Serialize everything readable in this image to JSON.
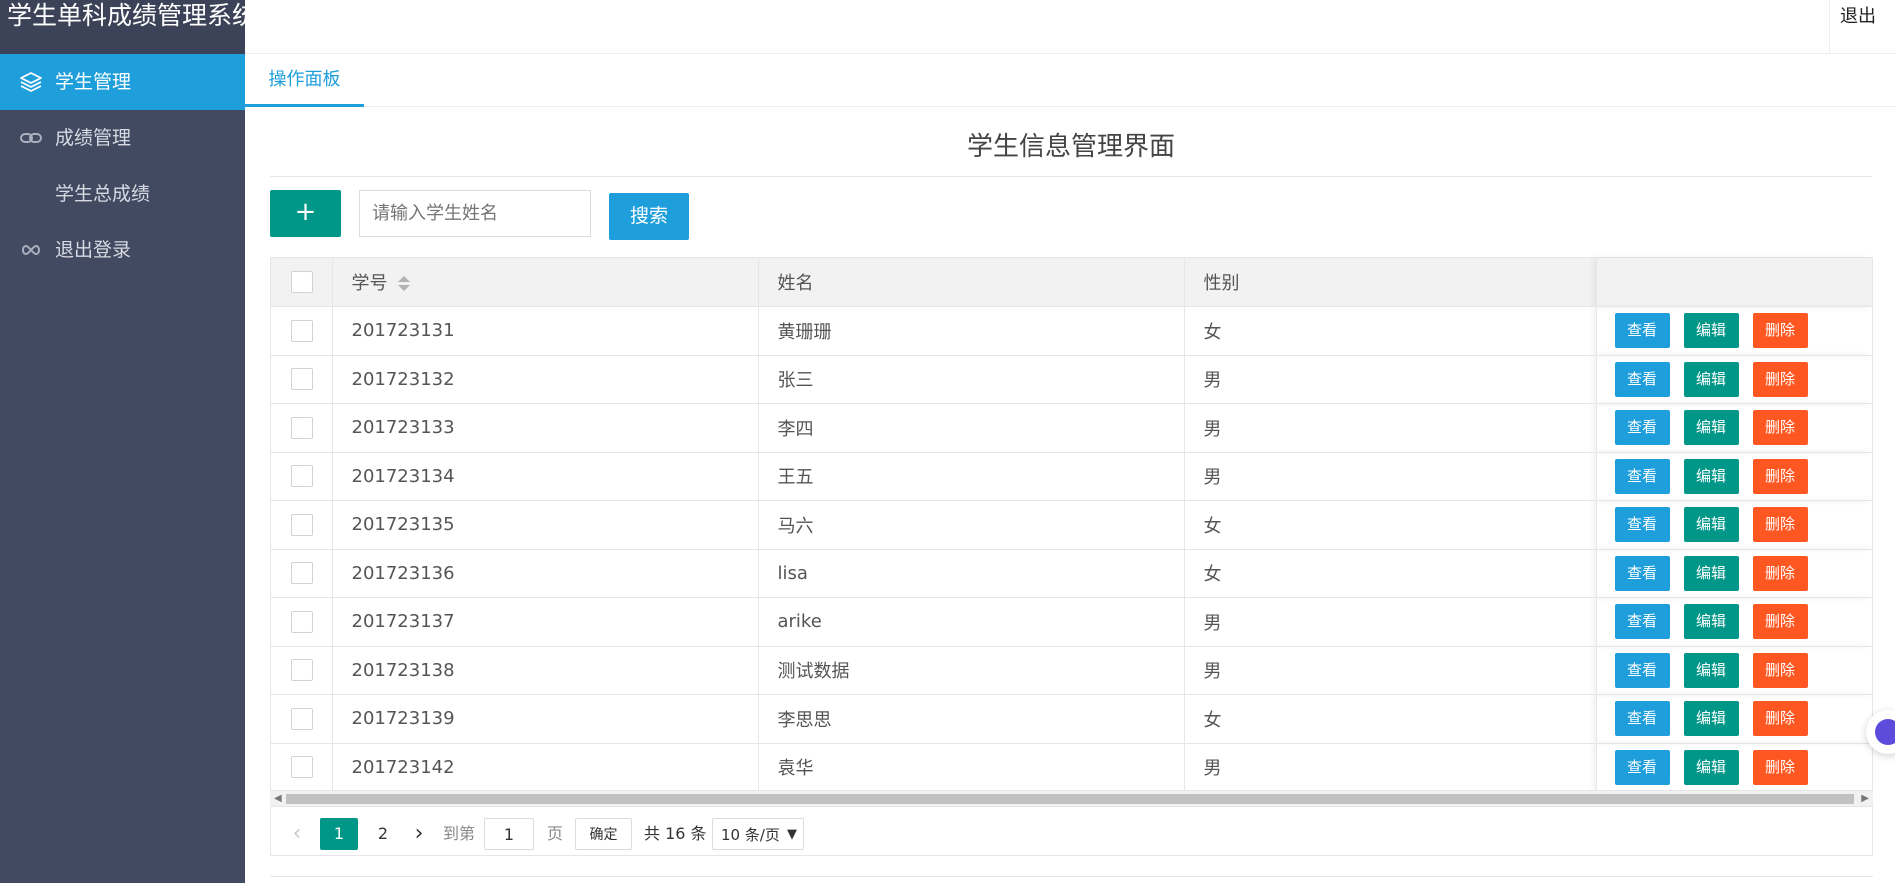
{
  "app": {
    "title": "学生单科成绩管理系统",
    "logout_label": "退出"
  },
  "sidebar": {
    "items": [
      {
        "label": "学生管理",
        "icon": "layers-icon",
        "active": true
      },
      {
        "label": "成绩管理",
        "icon": "link-icon",
        "active": false
      },
      {
        "label": "学生总成绩",
        "icon": "",
        "active": false
      },
      {
        "label": "退出登录",
        "icon": "infinity-icon",
        "active": false
      }
    ]
  },
  "tabs": [
    {
      "label": "操作面板",
      "active": true
    }
  ],
  "main": {
    "title": "学生信息管理界面",
    "add_label": "+",
    "search": {
      "placeholder": "请输入学生姓名",
      "value": ""
    },
    "search_label": "搜索"
  },
  "table": {
    "columns": [
      "学号",
      "姓名",
      "性别",
      ""
    ],
    "rows": [
      {
        "id": "201723131",
        "name": "黄珊珊",
        "gender": "女"
      },
      {
        "id": "201723132",
        "name": "张三",
        "gender": "男"
      },
      {
        "id": "201723133",
        "name": "李四",
        "gender": "男"
      },
      {
        "id": "201723134",
        "name": "王五",
        "gender": "男"
      },
      {
        "id": "201723135",
        "name": "马六",
        "gender": "女"
      },
      {
        "id": "201723136",
        "name": "lisa",
        "gender": "女"
      },
      {
        "id": "201723137",
        "name": "arike",
        "gender": "男"
      },
      {
        "id": "201723138",
        "name": "测试数据",
        "gender": "男"
      },
      {
        "id": "201723139",
        "name": "李思思",
        "gender": "女"
      },
      {
        "id": "201723142",
        "name": "袁华",
        "gender": "男"
      }
    ],
    "actions": {
      "view": "查看",
      "edit": "编辑",
      "delete": "删除"
    }
  },
  "pagination": {
    "prev": "‹",
    "next": "›",
    "current": "1",
    "pages": [
      "1",
      "2"
    ],
    "goto_label": "到第",
    "goto_value": "1",
    "page_unit": "页",
    "confirm": "确定",
    "total": "共 16 条",
    "page_size": "10 条/页"
  },
  "colors": {
    "sidebar_bg": "#424a61",
    "primary_blue": "#1e9fdb",
    "teal": "#009688",
    "danger": "#ff5722"
  }
}
